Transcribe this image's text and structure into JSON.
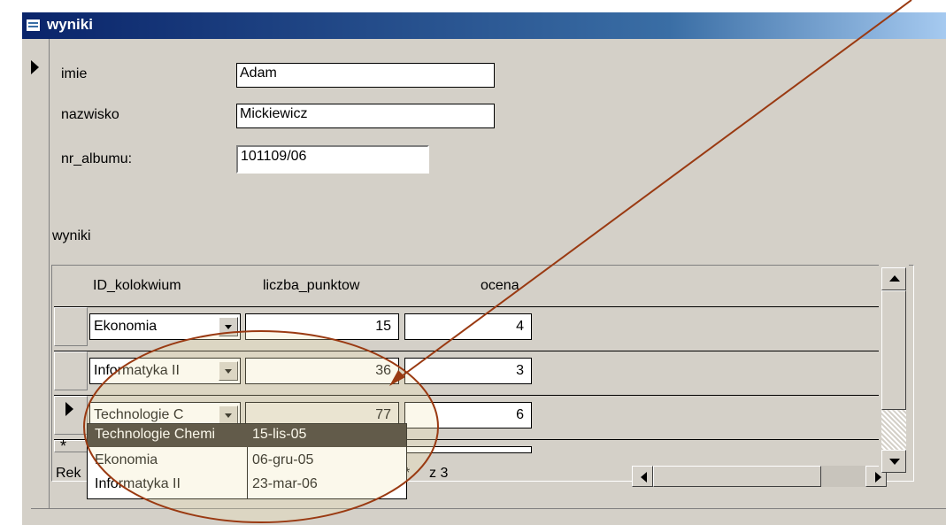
{
  "window": {
    "title": "wyniki"
  },
  "form": {
    "fields": [
      {
        "label": "imie",
        "value": "Adam"
      },
      {
        "label": "nazwisko",
        "value": "Mickiewicz"
      },
      {
        "label": "nr_albumu:",
        "value": "101109/06"
      }
    ],
    "subform_label": "wyniki"
  },
  "subform": {
    "columns": [
      "ID_kolokwium",
      "liczba_punktow",
      "ocena"
    ],
    "rows": [
      {
        "kolokwium": "Ekonomia",
        "punkty": "15",
        "ocena": "4"
      },
      {
        "kolokwium": "Informatyka II",
        "punkty": "36",
        "ocena": "3"
      },
      {
        "kolokwium": "Technologie C",
        "punkty": "77",
        "ocena": "6"
      }
    ],
    "new_row_marker": "*",
    "nav_label": "Rek",
    "nav_new": "*",
    "nav_total": "z 3"
  },
  "dropdown": {
    "items": [
      {
        "name": "Technologie Chemi",
        "date": "15-lis-05"
      },
      {
        "name": "Ekonomia",
        "date": "06-gru-05"
      },
      {
        "name": "Informatyka II",
        "date": "23-mar-06"
      }
    ]
  },
  "annotation_colors": {
    "arrow": "#9a3a12",
    "ellipse": "#9a3a12",
    "highlight": "#f2e6b8"
  }
}
